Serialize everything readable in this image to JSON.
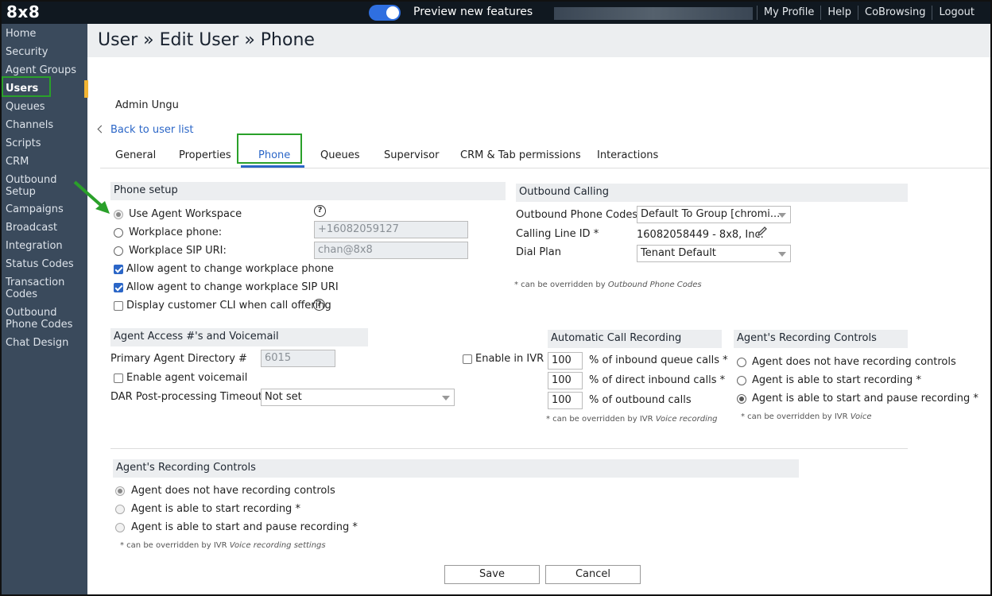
{
  "topbar": {
    "logo": "8x8",
    "preview_label": "Preview new features",
    "nav": [
      "My Profile",
      "Help",
      "CoBrowsing",
      "Logout"
    ]
  },
  "sidebar": {
    "items": [
      "Home",
      "Security",
      "Agent Groups",
      "Users",
      "Queues",
      "Channels",
      "Scripts",
      "CRM",
      "Outbound Setup",
      "Campaigns",
      "Broadcast",
      "Integration",
      "Status Codes",
      "Transaction Codes",
      "Outbound Phone Codes",
      "Chat Design"
    ],
    "active": "Users"
  },
  "page": {
    "title": "User » Edit User » Phone",
    "user_name": "Admin Ungu",
    "back_link": "Back to user list"
  },
  "tabs": [
    "General",
    "Properties",
    "Phone",
    "Queues",
    "Supervisor",
    "CRM & Tab permissions",
    "Interactions"
  ],
  "active_tab": "Phone",
  "phone_setup": {
    "header": "Phone setup",
    "opt_agent_workspace": "Use Agent Workspace",
    "opt_workplace_phone": "Workplace phone:",
    "opt_sip_uri": "Workplace SIP URI:",
    "workplace_phone_value": "+16082059127",
    "sip_uri_value": "chan@8x8",
    "allow_phone": "Allow agent to change workplace phone",
    "allow_sip": "Allow agent to change workplace SIP URI",
    "display_cli": "Display customer CLI when call offering"
  },
  "outbound": {
    "header": "Outbound Calling",
    "phone_codes_label": "Outbound Phone Codes",
    "phone_codes_value": "Default To Group [chromi...",
    "caller_id_label": "Calling Line ID *",
    "caller_id_value": "16082058449 - 8x8, Inc.",
    "dial_plan_label": "Dial Plan",
    "dial_plan_value": "Tenant Default",
    "note_prefix": "* can be overridden by ",
    "note_italic": "Outbound Phone Codes"
  },
  "agent_access": {
    "header": "Agent Access #'s and Voicemail",
    "primary_label": "Primary Agent Directory #",
    "primary_value": "6015",
    "enable_ivr": "Enable in IVR",
    "voicemail": "Enable agent voicemail",
    "dar_label": "DAR Post-processing Timeout",
    "dar_value": "Not set"
  },
  "auto_recording": {
    "header": "Automatic Call Recording",
    "rows": [
      {
        "value": "100",
        "label": "% of inbound queue calls *"
      },
      {
        "value": "100",
        "label": "% of direct inbound calls *"
      },
      {
        "value": "100",
        "label": "% of outbound calls"
      }
    ],
    "note_prefix": "* can be overridden by IVR ",
    "note_italic": "Voice recording"
  },
  "recording_controls_right": {
    "header": "Agent's Recording Controls",
    "options": [
      "Agent does not have recording controls",
      "Agent is able to start recording *",
      "Agent is able to start and pause recording *"
    ],
    "note_prefix": "* can be overridden by IVR ",
    "note_italic": "Voice"
  },
  "recording_controls_bottom": {
    "header": "Agent's Recording Controls",
    "options": [
      "Agent does not have recording controls",
      "Agent is able to start recording *",
      "Agent is able to start and pause recording *"
    ],
    "note_prefix": "* can be overridden by IVR ",
    "note_italic": "Voice recording settings"
  },
  "actions": {
    "save": "Save",
    "cancel": "Cancel"
  },
  "colors": {
    "accent": "#2b66c7",
    "highlight": "#2aa02a",
    "sidebar": "#3a4a5c",
    "topbar": "#101820"
  }
}
